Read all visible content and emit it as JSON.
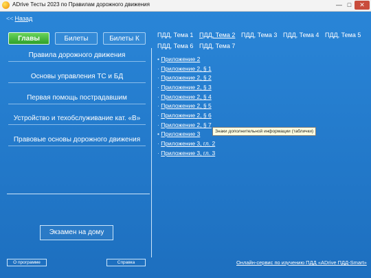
{
  "window": {
    "title": "ADrive Тесты 2023 по Правилам дорожного движения",
    "controls": {
      "minimize": "—",
      "maximize": "□",
      "close": "✕"
    }
  },
  "nav": {
    "back_icon": "<<",
    "back_label": "Назад"
  },
  "tabs": [
    {
      "label": "Главы",
      "active": true
    },
    {
      "label": "Билеты",
      "active": false
    },
    {
      "label": "Билеты К",
      "active": false
    }
  ],
  "chapters": [
    "Правила дорожного движения",
    "Основы управления ТС и БД",
    "Первая помощь пострадавшим",
    "Устройство и техобслуживание кат. «B»",
    "Правовые основы дорожного движения"
  ],
  "exam_button": "Экзамен на дому",
  "footer": {
    "about": "О программе",
    "help": "Справка",
    "service_link": "Онлайн-сервис по изучению ПДД «ADrive ПДД-Smart»"
  },
  "topics": [
    {
      "label": "ПДД, Тема 1",
      "active": false
    },
    {
      "label": "ПДД, Тема 2",
      "active": true
    },
    {
      "label": "ПДД, Тема 3",
      "active": false
    },
    {
      "label": "ПДД, Тема 4",
      "active": false
    },
    {
      "label": "ПДД, Тема 5",
      "active": false
    },
    {
      "label": "ПДД, Тема 6",
      "active": false
    },
    {
      "label": "ПДД, Тема 7",
      "active": false
    }
  ],
  "tree": [
    {
      "bullet": "•",
      "label": "Приложение 2"
    },
    {
      "bullet": "·",
      "label": "Приложение 2, § 1"
    },
    {
      "bullet": "·",
      "label": "Приложение 2, § 2"
    },
    {
      "bullet": "·",
      "label": "Приложение 2, § 3"
    },
    {
      "bullet": "·",
      "label": "Приложение 2, § 4"
    },
    {
      "bullet": "·",
      "label": "Приложение 2, § 5"
    },
    {
      "bullet": "·",
      "label": "Приложение 2, § 6"
    },
    {
      "bullet": "·",
      "label": "Приложение 2, § 7"
    },
    {
      "bullet": "•",
      "label": "Приложение 3"
    },
    {
      "bullet": "·",
      "label": "Приложение 3, гл. 2"
    },
    {
      "bullet": "·",
      "label": "Приложение 3, гл. 3"
    }
  ],
  "tooltip": "Знаки дополнительной информации (таблички)",
  "colors": {
    "active_tab": "#3fb837",
    "background": "#2277c9",
    "tooltip_bg": "#ffffe1"
  }
}
